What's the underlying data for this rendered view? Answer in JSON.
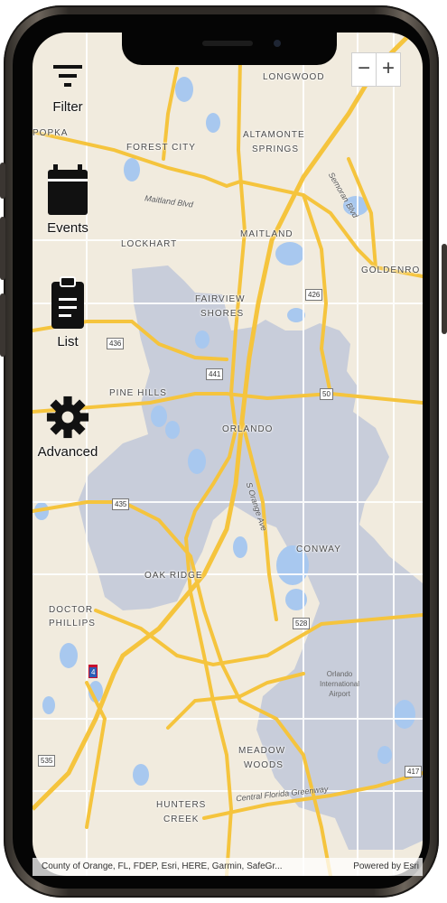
{
  "menu": {
    "filter": "Filter",
    "events": "Events",
    "list": "List",
    "advanced": "Advanced"
  },
  "zoom": {
    "minus": "−",
    "plus": "+"
  },
  "places": {
    "longwood": "LONGWOOD",
    "apopka": "POPKA",
    "forest_city": "FOREST CITY",
    "altamonte": "ALTAMONTE",
    "springs": "SPRINGS",
    "lockhart": "LOCKHART",
    "maitland": "MAITLAND",
    "goldenrod": "GOLDENRO",
    "fairview": "FAIRVIEW",
    "shores": "SHORES",
    "pine_hills": "PINE HILLS",
    "orlando": "ORLANDO",
    "conway": "CONWAY",
    "oak_ridge": "OAK RIDGE",
    "doctor": "DOCTOR",
    "phillips": "PHILLIPS",
    "meadow": "MEADOW",
    "woods": "WOODS",
    "hunters": "HUNTERS",
    "creek": "CREEK"
  },
  "roads": {
    "maitland_blvd": "Maitland Blvd",
    "semoran_blvd": "Semoran Blvd",
    "orange_ave": "S Orange Ave",
    "greenway": "Central Florida Greenway"
  },
  "shields": [
    "426",
    "436",
    "441",
    "50",
    "435",
    "528",
    "535",
    "417",
    "4"
  ],
  "airport": {
    "line1": "Orlando",
    "line2": "International",
    "line3": "Airport"
  },
  "attribution": {
    "left": "County of Orange, FL, FDEP, Esri, HERE, Garmin, SafeGr...",
    "right": "Powered by Esri"
  },
  "colors": {
    "region": "#c5cbd9",
    "water": "#a8c8ef",
    "highway": "#f5c43d",
    "land": "#f1ebde"
  }
}
